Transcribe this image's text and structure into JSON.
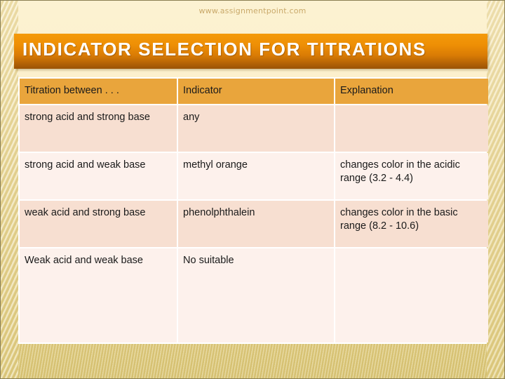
{
  "slide": {
    "watermark": "www.assignmentpoint.com",
    "title": "INDICATOR SELECTION FOR TITRATIONS"
  },
  "colors": {
    "banner_top": "#F49A0B",
    "banner_bottom": "#9A5205",
    "header_cell": "#E9A53C",
    "row_dark": "#F7DFD1",
    "row_light": "#FDF1EC",
    "background_cream": "#FBEFC9",
    "background_tan": "#E2CE81",
    "watermark_text": "#C9A96A"
  },
  "table": {
    "headers": [
      "Titration between . . .",
      "Indicator",
      "Explanation"
    ],
    "rows": [
      {
        "titration": "strong acid and strong base",
        "indicator": "any",
        "explanation": ""
      },
      {
        "titration": "strong acid and weak base",
        "indicator": "methyl orange",
        "explanation": "changes color in the acidic range (3.2 - 4.4)"
      },
      {
        "titration": " weak acid and strong base",
        "indicator": "phenolphthalein",
        "explanation": "changes color in the basic range (8.2 - 10.6)"
      },
      {
        "titration": "Weak acid and weak base",
        "indicator": "No suitable",
        "explanation": ""
      }
    ]
  }
}
